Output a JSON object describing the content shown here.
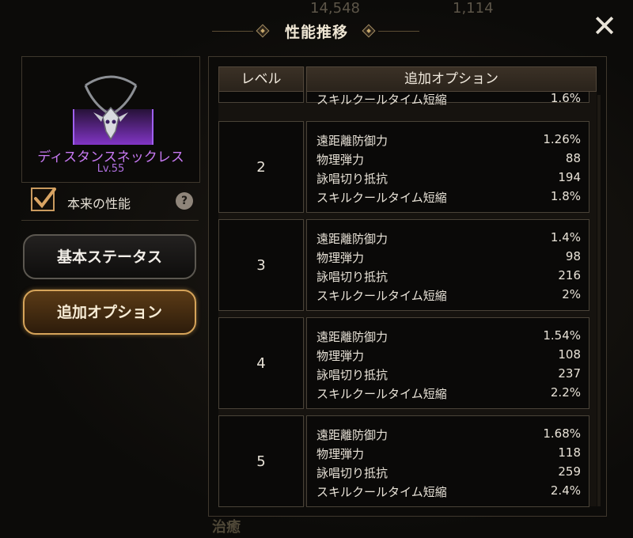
{
  "background": {
    "top_values": [
      "14,548",
      "1,114"
    ],
    "bottom_text": "治癒"
  },
  "dialog": {
    "title": "性能推移",
    "close_icon": "close-icon"
  },
  "item": {
    "name": "ディスタンスネックレス",
    "level": "Lv.55",
    "name_color": "#c779f2"
  },
  "toggle": {
    "label": "本来の性能",
    "checked": true,
    "help": "?"
  },
  "buttons": {
    "basic": "基本ステータス",
    "option": "追加オプション"
  },
  "table": {
    "headers": {
      "level": "レベル",
      "option": "追加オプション"
    },
    "partial_row": {
      "name": "スキルクールタイム短縮",
      "value": "1.6%"
    },
    "rows": [
      {
        "level": "2",
        "options": [
          {
            "name": "遠距離防御力",
            "value": "1.26%"
          },
          {
            "name": "物理弾力",
            "value": "88"
          },
          {
            "name": "詠唱切り抵抗",
            "value": "194"
          },
          {
            "name": "スキルクールタイム短縮",
            "value": "1.8%"
          }
        ]
      },
      {
        "level": "3",
        "options": [
          {
            "name": "遠距離防御力",
            "value": "1.4%"
          },
          {
            "name": "物理弾力",
            "value": "98"
          },
          {
            "name": "詠唱切り抵抗",
            "value": "216"
          },
          {
            "name": "スキルクールタイム短縮",
            "value": "2%"
          }
        ]
      },
      {
        "level": "4",
        "options": [
          {
            "name": "遠距離防御力",
            "value": "1.54%"
          },
          {
            "name": "物理弾力",
            "value": "108"
          },
          {
            "name": "詠唱切り抵抗",
            "value": "237"
          },
          {
            "name": "スキルクールタイム短縮",
            "value": "2.2%"
          }
        ]
      },
      {
        "level": "5",
        "options": [
          {
            "name": "遠距離防御力",
            "value": "1.68%"
          },
          {
            "name": "物理弾力",
            "value": "118"
          },
          {
            "name": "詠唱切り抵抗",
            "value": "259"
          },
          {
            "name": "スキルクールタイム短縮",
            "value": "2.4%"
          }
        ]
      }
    ]
  }
}
